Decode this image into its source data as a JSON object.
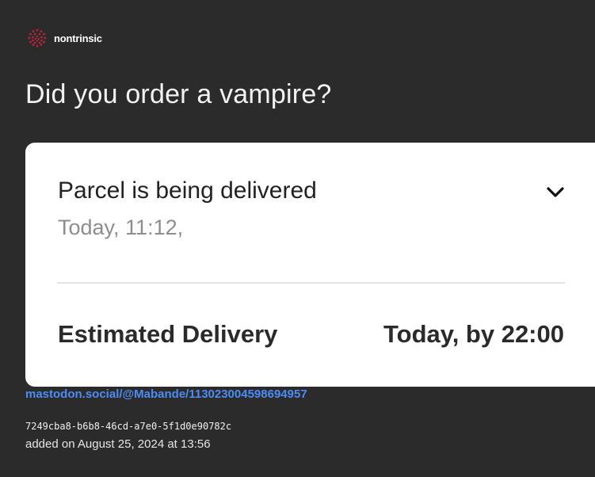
{
  "brand": {
    "name": "nontrinsic",
    "logo_icon": "nontrinsic-logo-icon",
    "logo_color": "#c0223a"
  },
  "title": "Did you order a vampire?",
  "card": {
    "status": "Parcel is being delivered",
    "status_time": "Today, 11:12,",
    "expand_icon": "chevron-down-icon",
    "estimated_label": "Estimated Delivery",
    "estimated_value": "Today, by 22:00"
  },
  "source_link": "mastodon.social/@Mabande/113023004598694957",
  "record_id": "7249cba8-b6b8-46cd-a7e0-5f1d0e90782c",
  "added_on": "added on August 25, 2024 at 13:56",
  "colors": {
    "background": "#2b2b2b",
    "card": "#ffffff",
    "link": "#4d8cf5",
    "muted_text": "#8d8d8d"
  }
}
